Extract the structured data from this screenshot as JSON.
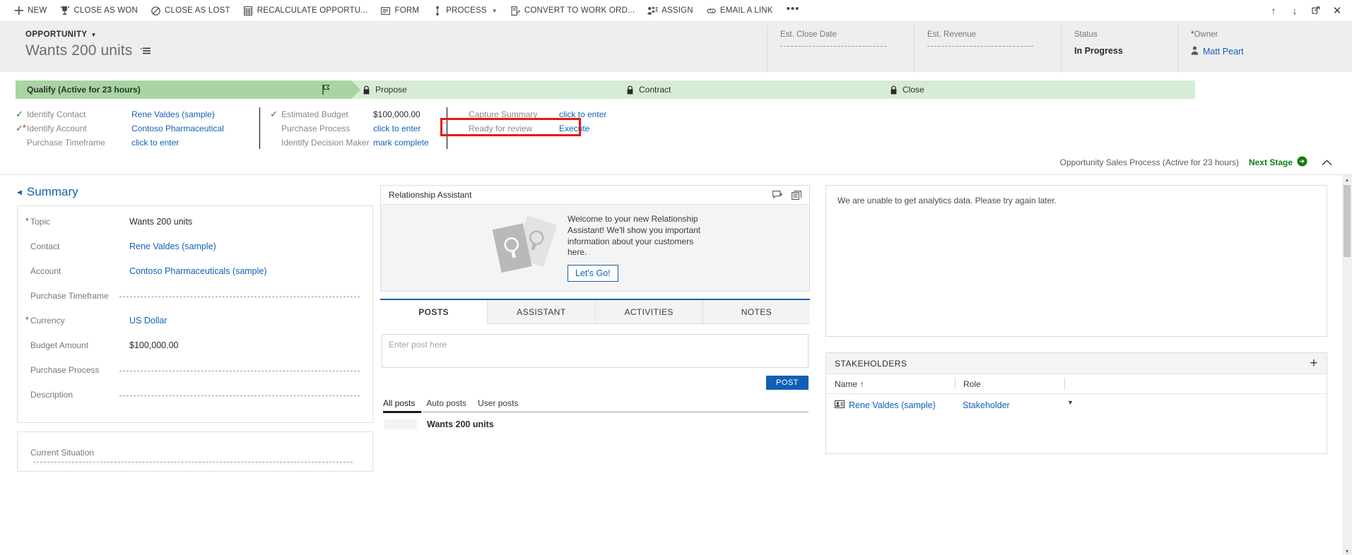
{
  "commandbar": {
    "items": [
      {
        "label": "NEW",
        "icon": "plus-icon",
        "caret": false
      },
      {
        "label": "CLOSE AS WON",
        "icon": "trophy-icon",
        "caret": false
      },
      {
        "label": "CLOSE AS LOST",
        "icon": "ban-icon",
        "caret": false
      },
      {
        "label": "RECALCULATE OPPORTU...",
        "icon": "calculator-icon",
        "caret": false
      },
      {
        "label": "FORM",
        "icon": "form-icon",
        "caret": false
      },
      {
        "label": "PROCESS",
        "icon": "process-icon",
        "caret": true
      },
      {
        "label": "CONVERT TO WORK ORD...",
        "icon": "convert-icon",
        "caret": false
      },
      {
        "label": "ASSIGN",
        "icon": "assign-icon",
        "caret": false
      },
      {
        "label": "EMAIL A LINK",
        "icon": "link-icon",
        "caret": false
      }
    ],
    "overflow": "•••",
    "window_controls": [
      {
        "name": "up-arrow-icon",
        "glyph": "↑"
      },
      {
        "name": "down-arrow-icon",
        "glyph": "↓"
      },
      {
        "name": "popout-icon",
        "glyph": "↗"
      },
      {
        "name": "close-icon",
        "glyph": "✕"
      }
    ]
  },
  "header": {
    "entity_type": "OPPORTUNITY",
    "record_title": "Wants 200 units",
    "fields": [
      {
        "label": "Est. Close Date",
        "value": "",
        "required": false,
        "dashed": true
      },
      {
        "label": "Est. Revenue",
        "value": "",
        "required": false,
        "dashed": true
      },
      {
        "label": "Status",
        "value": "In Progress",
        "required": false,
        "dashed": false
      },
      {
        "label": "Owner",
        "value": "Matt Peart",
        "required": true,
        "dashed": false,
        "link": true
      }
    ]
  },
  "process": {
    "stages": [
      {
        "label": "Qualify (Active for 23 hours)",
        "state": "active",
        "locked": false
      },
      {
        "label": "Propose",
        "state": "future",
        "locked": true
      },
      {
        "label": "Contract",
        "state": "future",
        "locked": true
      },
      {
        "label": "Close",
        "state": "future",
        "locked": true
      }
    ],
    "groups": [
      {
        "rows": [
          {
            "checked": true,
            "required": false,
            "label": "Identify Contact",
            "value": "Rene Valdes (sample)",
            "link": true
          },
          {
            "checked": true,
            "required": true,
            "label": "Identify Account",
            "value": "Contoso Pharmaceutical",
            "link": true
          },
          {
            "checked": false,
            "required": false,
            "label": "Purchase Timeframe",
            "value": "click to enter",
            "link": true
          }
        ]
      },
      {
        "rows": [
          {
            "checked": true,
            "required": false,
            "label": "Estimated Budget",
            "value": "$100,000.00",
            "link": false
          },
          {
            "checked": false,
            "required": false,
            "label": "Purchase Process",
            "value": "click to enter",
            "link": true
          },
          {
            "checked": false,
            "required": false,
            "label": "Identify Decision Maker",
            "value": "mark complete",
            "link": true
          }
        ]
      },
      {
        "rows": [
          {
            "checked": false,
            "required": false,
            "label": "Capture Summary",
            "value": "click to enter",
            "link": true
          },
          {
            "checked": false,
            "required": false,
            "label": "Ready for review",
            "value": "Execute",
            "link": true
          }
        ]
      }
    ],
    "footer_name": "Opportunity Sales Process (Active for 23 hours)",
    "next_stage_label": "Next Stage",
    "highlight_color": "#e8170f"
  },
  "summary": {
    "section_title": "Summary",
    "fields": [
      {
        "label": "Topic",
        "value": "Wants 200 units",
        "required": true,
        "link": false,
        "dashed": false
      },
      {
        "label": "Contact",
        "value": "Rene Valdes (sample)",
        "required": false,
        "link": true,
        "dashed": false
      },
      {
        "label": "Account",
        "value": "Contoso Pharmaceuticals (sample)",
        "required": false,
        "link": true,
        "dashed": false
      },
      {
        "label": "Purchase Timeframe",
        "value": "",
        "required": false,
        "link": false,
        "dashed": true
      },
      {
        "label": "Currency",
        "value": "US Dollar",
        "required": true,
        "link": true,
        "dashed": false
      },
      {
        "label": "Budget Amount",
        "value": "$100,000.00",
        "required": false,
        "link": false,
        "dashed": false
      },
      {
        "label": "Purchase Process",
        "value": "",
        "required": false,
        "link": false,
        "dashed": true
      },
      {
        "label": "Description",
        "value": "",
        "required": false,
        "link": false,
        "dashed": true
      }
    ],
    "current_situation_label": "Current Situation"
  },
  "relationship_assistant": {
    "title": "Relationship Assistant",
    "welcome_text": "Welcome to your new Relationship Assistant! We'll show you important information about your customers here.",
    "cta_label": "Let's Go!"
  },
  "social": {
    "tabs": [
      {
        "label": "POSTS",
        "selected": true
      },
      {
        "label": "ASSISTANT",
        "selected": false
      },
      {
        "label": "ACTIVITIES",
        "selected": false
      },
      {
        "label": "NOTES",
        "selected": false
      }
    ],
    "post_placeholder": "Enter post here",
    "post_button": "POST",
    "filters": [
      {
        "label": "All posts",
        "selected": true
      },
      {
        "label": "Auto posts",
        "selected": false
      },
      {
        "label": "User posts",
        "selected": false
      }
    ],
    "feed": [
      {
        "title": "Wants 200 units"
      }
    ]
  },
  "analytics": {
    "message": "We are unable to get analytics data. Please try again later."
  },
  "stakeholders": {
    "title": "STAKEHOLDERS",
    "columns": [
      "Name ↑",
      "Role"
    ],
    "rows": [
      {
        "name": "Rene Valdes (sample)",
        "role": "Stakeholder"
      }
    ]
  }
}
